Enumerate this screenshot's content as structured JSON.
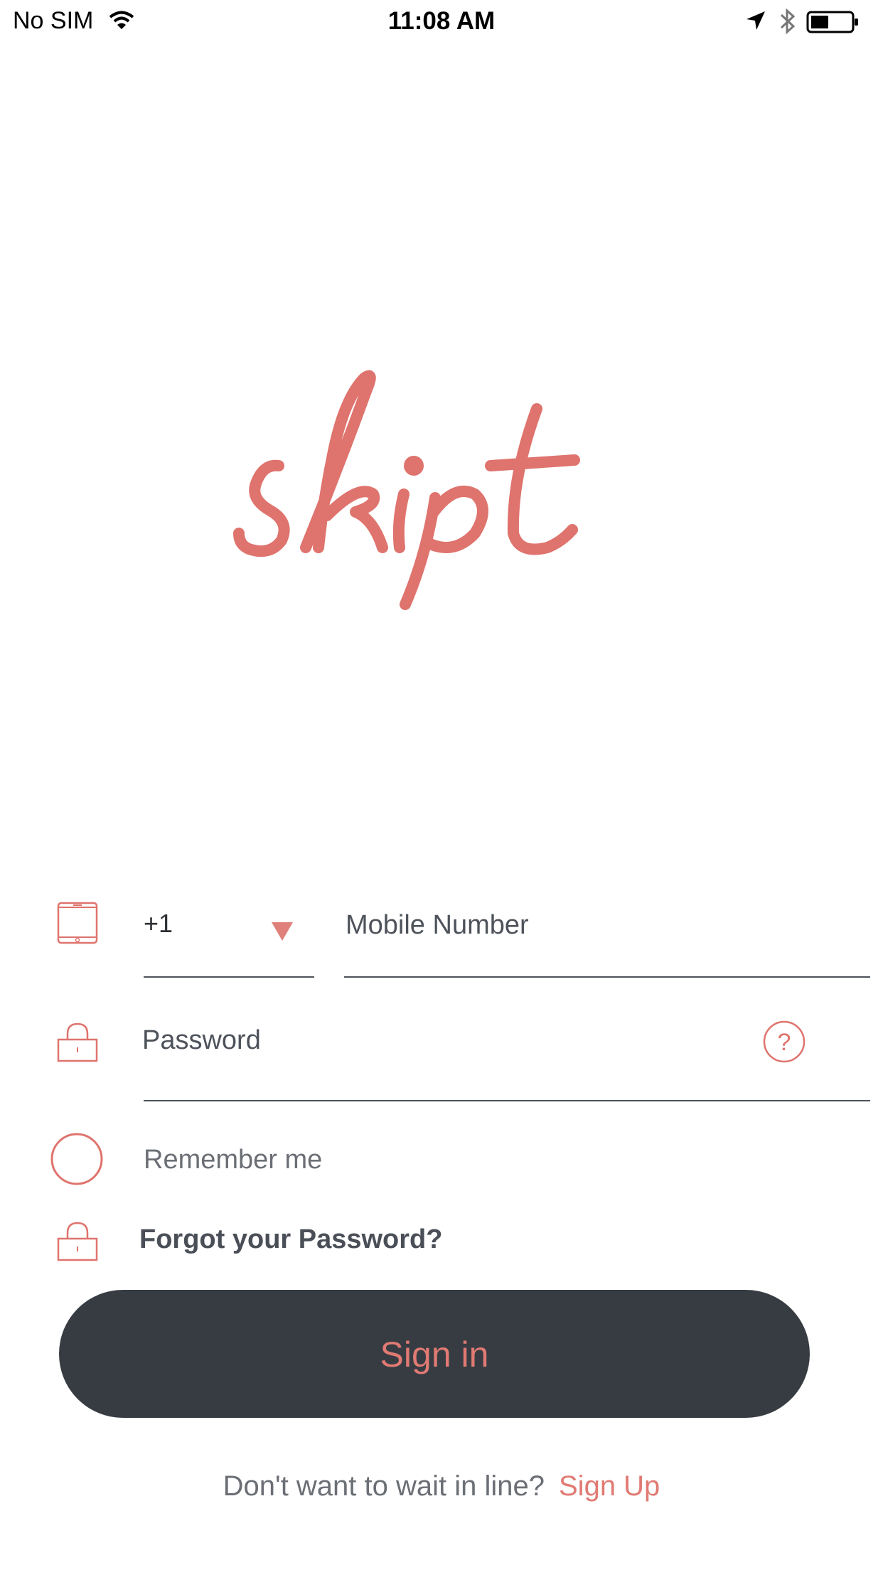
{
  "status_bar": {
    "carrier": "No SIM",
    "time": "11:08 AM"
  },
  "logo": {
    "text": "skipt",
    "color": "#df736d"
  },
  "form": {
    "country_code": "+1",
    "mobile_placeholder": "Mobile Number",
    "password_placeholder": "Password",
    "help_symbol": "?",
    "remember_label": "Remember me",
    "forgot_label": "Forgot your Password?"
  },
  "actions": {
    "signin_label": "Sign in",
    "signup_prompt": "Don't want to wait in line?",
    "signup_label": "Sign Up"
  },
  "colors": {
    "accent": "#e07a73",
    "button_bg": "#373c43",
    "text": "#3a3f46"
  },
  "icons": [
    "wifi-icon",
    "location-arrow-icon",
    "bluetooth-icon",
    "battery-icon",
    "tablet-icon",
    "dropdown-triangle-icon",
    "lock-icon",
    "help-icon",
    "radio-icon"
  ]
}
